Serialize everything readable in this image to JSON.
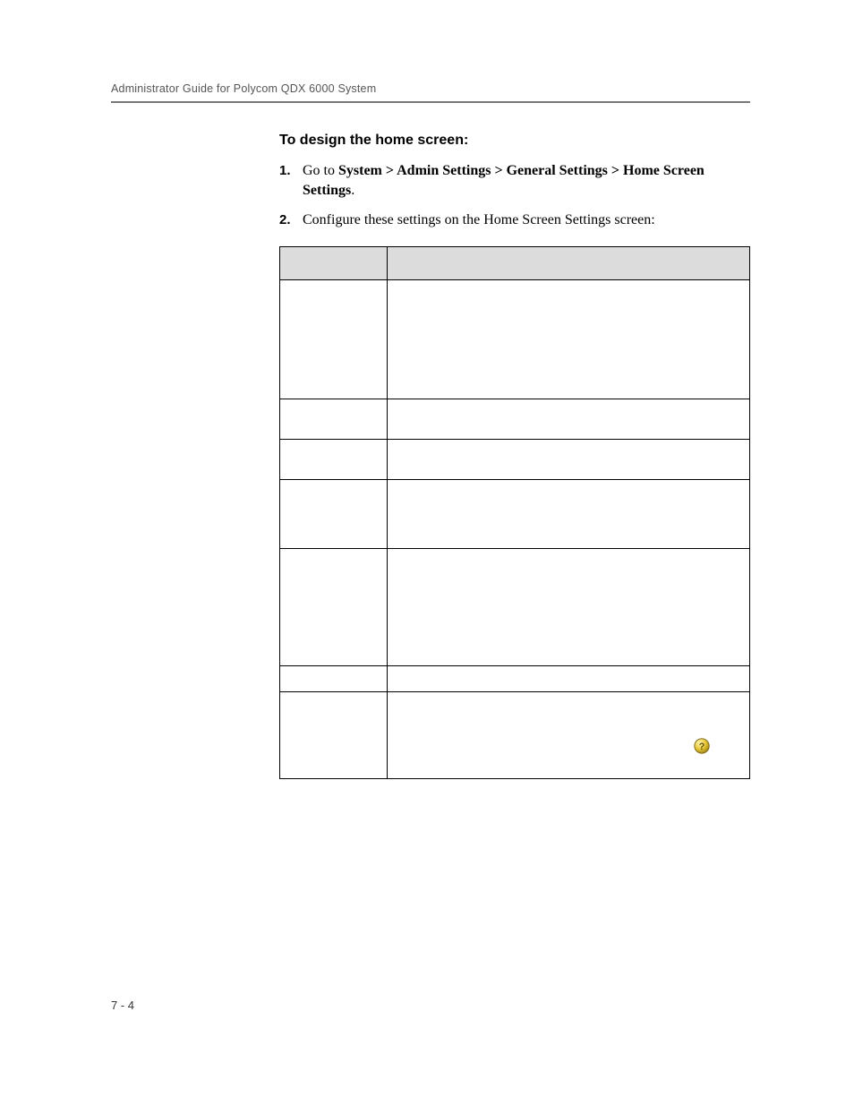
{
  "header": {
    "running_head": "Administrator Guide for Polycom QDX 6000 System"
  },
  "section": {
    "title": "To design the home screen:",
    "steps": [
      {
        "num": "1.",
        "lead": "Go to ",
        "path": "System > Admin Settings > General Settings > Home Screen Settings",
        "tail": "."
      },
      {
        "num": "2.",
        "text": "Configure these settings on the Home Screen Settings screen:"
      }
    ]
  },
  "table": {
    "columns": [
      "",
      ""
    ],
    "rows": [
      {
        "setting": "",
        "description": ""
      },
      {
        "setting": "",
        "description": ""
      },
      {
        "setting": "",
        "description": ""
      },
      {
        "setting": "",
        "description": ""
      },
      {
        "setting": "",
        "description": ""
      },
      {
        "setting": "",
        "description": ""
      },
      {
        "setting": "",
        "description": ""
      }
    ]
  },
  "icons": {
    "help": "help-icon"
  },
  "footer": {
    "page_number": "7 - 4"
  }
}
